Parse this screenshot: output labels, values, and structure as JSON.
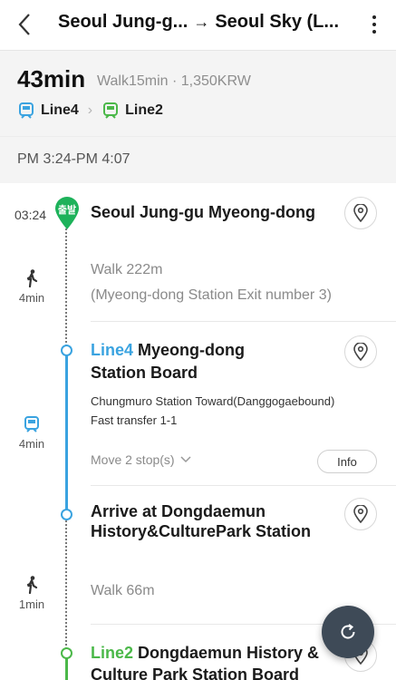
{
  "header": {
    "origin": "Seoul Jung-g...",
    "arrow": "→",
    "destination": "Seoul Sky (L..."
  },
  "summary": {
    "duration": "43min",
    "meta": "Walk15min · 1,350KRW",
    "lines": [
      "Line4",
      "Line2"
    ],
    "time_range": "PM 3:24-PM 4:07"
  },
  "colors": {
    "line4": "#3aa3e0",
    "line2": "#4bb849",
    "fab": "#3e4a57"
  },
  "timeline": {
    "start": {
      "time": "03:24",
      "badge": "출발",
      "title": "Seoul Jung-gu Myeong-dong"
    },
    "walk1": {
      "duration": "4min",
      "distance": "Walk 222m",
      "detail": "(Myeong-dong Station Exit number 3)"
    },
    "board1": {
      "line": "Line4",
      "title_line1": " Myeong-dong",
      "title_line2": "Station Board",
      "direction": "Chungmuro Station Toward(Danggogaebound)",
      "transfer": "Fast transfer 1-1",
      "duration": "4min",
      "move_stops": "Move 2 stop(s)",
      "info": "Info"
    },
    "arrive1": {
      "title_line1": "Arrive at Dongdaemun",
      "title_line2": "History&CulturePark Station"
    },
    "walk2": {
      "duration": "1min",
      "distance": "Walk 66m"
    },
    "board2": {
      "line": "Line2",
      "title_line1": " Dongdaemun History &",
      "title_line2": "Culture Park Station Board"
    }
  },
  "icons": [
    "back-arrow-icon",
    "more-vert-icon",
    "subway-icon",
    "chevron-right-icon",
    "location-pin-icon",
    "walking-person-icon",
    "chevron-down-icon",
    "refresh-icon"
  ]
}
